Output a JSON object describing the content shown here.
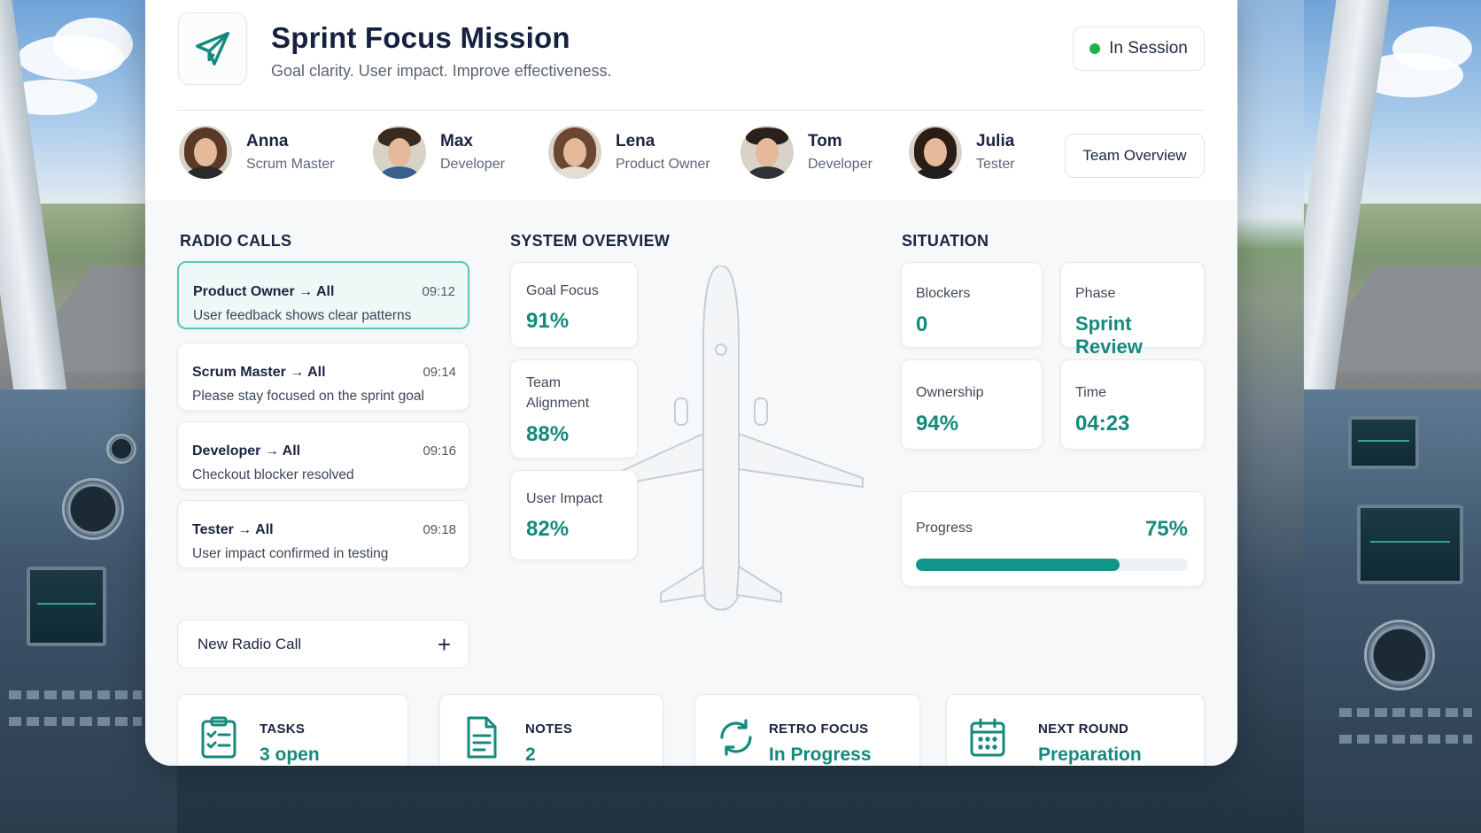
{
  "header": {
    "title": "Sprint Focus Mission",
    "subtitle": "Goal clarity. User impact. Improve effectiveness.",
    "status": "In Session",
    "logo_icon": "paper-plane-icon"
  },
  "team": {
    "members": [
      {
        "name": "Anna",
        "role": "Scrum Master"
      },
      {
        "name": "Max",
        "role": "Developer"
      },
      {
        "name": "Lena",
        "role": "Product Owner"
      },
      {
        "name": "Tom",
        "role": "Developer"
      },
      {
        "name": "Julia",
        "role": "Tester"
      }
    ],
    "overview_button": "Team Overview"
  },
  "radio_calls": {
    "title": "RADIO CALLS",
    "items": [
      {
        "from": "Product Owner → All",
        "time": "09:12",
        "message": "User feedback shows clear patterns"
      },
      {
        "from": "Scrum Master → All",
        "time": "09:14",
        "message": "Please stay focused on the sprint goal"
      },
      {
        "from": "Developer → All",
        "time": "09:16",
        "message": "Checkout blocker resolved"
      },
      {
        "from": "Tester → All",
        "time": "09:18",
        "message": "User impact confirmed in testing"
      }
    ],
    "new_call_label": "New Radio Call"
  },
  "system_overview": {
    "title": "SYSTEM OVERVIEW",
    "metrics": [
      {
        "label": "Goal Focus",
        "value": "91%"
      },
      {
        "label": "Team Alignment",
        "value": "88%"
      },
      {
        "label": "User Impact",
        "value": "82%"
      }
    ]
  },
  "situation": {
    "title": "SITUATION",
    "blockers_label": "Blockers",
    "blockers_value": "0",
    "phase_label": "Phase",
    "phase_value": "Sprint Review",
    "ownership_label": "Ownership",
    "ownership_value": "94%",
    "time_label": "Time",
    "time_value": "04:23",
    "progress_label": "Progress",
    "progress_value": "75%",
    "progress_fraction": 0.75
  },
  "tiles": [
    {
      "label": "TASKS",
      "value": "3 open",
      "icon": "clipboard-checklist-icon"
    },
    {
      "label": "NOTES",
      "value": "2",
      "icon": "document-icon"
    },
    {
      "label": "RETRO FOCUS",
      "value": "In Progress",
      "icon": "refresh-cycle-icon"
    },
    {
      "label": "NEXT ROUND",
      "value": "Preparation",
      "icon": "calendar-icon"
    }
  ],
  "colors": {
    "accent": "#148a7d",
    "status_green": "#1fb24a",
    "active_call_border": "#5cc6b2"
  }
}
